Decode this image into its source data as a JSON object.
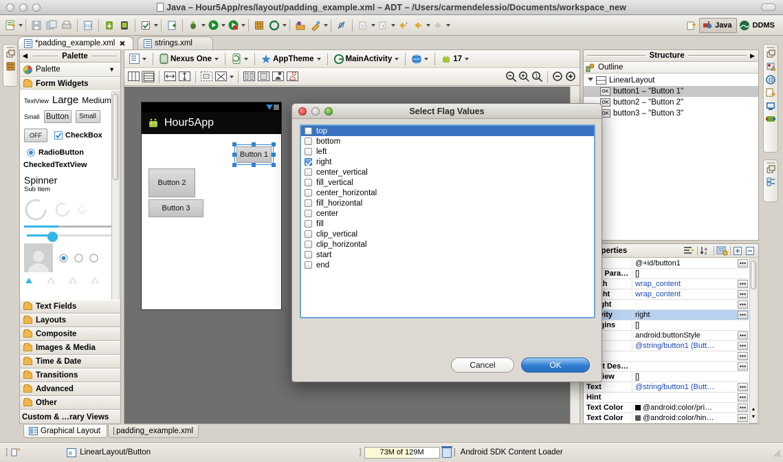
{
  "window": {
    "title": "Java – Hour5App/res/layout/padding_example.xml – ADT – /Users/carmendelessio/Documents/workspace_new",
    "doc_icon": "document-icon"
  },
  "toolbar": {
    "perspective_java": "Java",
    "perspective_ddms": "DDMS",
    "icons": [
      "new-wizard-icon",
      "save-icon",
      "save-all-icon",
      "print-icon",
      "open-xml-icon",
      "sdk-manager-icon",
      "avd-manager-icon",
      "checkmark-icon",
      "new-android-project-icon",
      "debug-icon",
      "run-icon",
      "coverage-icon",
      "new-grid-icon",
      "external-tools-icon",
      "open-type-icon",
      "search-icon",
      "annotation-icon",
      "next-annotation-icon",
      "previous-annotation-icon",
      "back-icon",
      "forward-icon"
    ]
  },
  "tabs": [
    {
      "label": "*padding_example.xml",
      "active": true,
      "closeable": true
    },
    {
      "label": "strings.xml",
      "active": false,
      "closeable": false
    }
  ],
  "palette": {
    "view_title": "Palette",
    "combo_label": "Palette",
    "form_widgets": "Form Widgets",
    "widgets": {
      "textview": "TextView",
      "large": "Large",
      "medium": "Medium",
      "small_label": "Small",
      "button": "Button",
      "small_button": "Small",
      "toggle_off": "OFF",
      "checkbox": "CheckBox",
      "radiobutton": "RadioButton",
      "checkedtextview": "CheckedTextView",
      "spinner": "Spinner",
      "spinner_sub": "Sub Item"
    },
    "groups": [
      "Text Fields",
      "Layouts",
      "Composite",
      "Images & Media",
      "Time & Date",
      "Transitions",
      "Advanced",
      "Other"
    ],
    "custom_group": "Custom & …rary Views"
  },
  "editor": {
    "config": {
      "device": "Nexus One",
      "theme": "AppTheme",
      "activity": "MainActivity",
      "api_level": "17"
    },
    "zoom_icons": [
      "zoom-out-icon",
      "zoom-fit-icon",
      "zoom-100-icon",
      "zoom-minus-icon",
      "zoom-plus-icon"
    ],
    "layout_icons": [
      "vertical-split-icon",
      "horizontal-split-icon",
      "match-width-icon",
      "match-height-icon",
      "wrap-content-icon",
      "distribute-icon",
      "show-margins-icon",
      "show-padding-icon",
      "portrait-icon",
      "landscape-icon"
    ]
  },
  "preview": {
    "app_title": "Hour5App",
    "buttons": [
      {
        "label": "Button 1",
        "selected": true
      },
      {
        "label": "Button 2",
        "selected": false
      },
      {
        "label": "Button 3",
        "selected": false
      }
    ]
  },
  "structure": {
    "view_title": "Structure",
    "outline_label": "Outline",
    "root": "LinearLayout",
    "children": [
      {
        "icon": "OK",
        "label": "button1 – \"Button 1\"",
        "selected": true
      },
      {
        "icon": "OK",
        "label": "button2 – \"Button 2\"",
        "selected": false
      },
      {
        "icon": "OK",
        "label": "button3 – \"Button 3\"",
        "selected": false
      }
    ]
  },
  "properties": {
    "view_title": "roperties",
    "header_icons": [
      "sort-by-category-icon",
      "sort-alpha-icon",
      "show-advanced-icon",
      "expand-all-icon",
      "collapse-all-icon"
    ],
    "rows": [
      {
        "name": "",
        "value": "@+id/button1",
        "dots": true,
        "blue": false,
        "selected": false
      },
      {
        "name": "yout Para…",
        "value": "[]",
        "dots": false,
        "blue": false,
        "selected": false
      },
      {
        "name": "Width",
        "value": "wrap_content",
        "dots": true,
        "blue": true,
        "selected": false
      },
      {
        "name": "Height",
        "value": "wrap_content",
        "dots": true,
        "blue": true,
        "selected": false
      },
      {
        "name": "Weight",
        "value": "",
        "dots": true,
        "blue": false,
        "selected": false
      },
      {
        "name": "Gravity",
        "value": "right",
        "dots": true,
        "blue": false,
        "selected": true
      },
      {
        "name": "Margins",
        "value": "[]",
        "dots": false,
        "blue": false,
        "selected": false
      },
      {
        "name": "yle",
        "value": "android:buttonStyle",
        "dots": true,
        "blue": false,
        "selected": false
      },
      {
        "name": "xt",
        "value": "@string/button1 (Butt…",
        "dots": true,
        "blue": true,
        "selected": false
      },
      {
        "name": "nt",
        "value": "",
        "dots": true,
        "blue": false,
        "selected": false
      },
      {
        "name": "ntent Des…",
        "value": "",
        "dots": true,
        "blue": false,
        "selected": false
      },
      {
        "name": "extView",
        "value": "[]",
        "dots": false,
        "blue": false,
        "selected": false
      },
      {
        "name": "Text",
        "value": "@string/button1 (Butt…",
        "dots": true,
        "blue": true,
        "selected": false
      },
      {
        "name": "Hint",
        "value": "",
        "dots": true,
        "blue": false,
        "selected": false
      },
      {
        "name": "Text Color",
        "value": "@android:color/pri…",
        "dots": true,
        "blue": false,
        "selected": false,
        "swatch": "#000000"
      },
      {
        "name": "Text Color",
        "value": "@android:color/hin…",
        "dots": true,
        "blue": false,
        "selected": false,
        "swatch": "#555555"
      }
    ]
  },
  "dialog": {
    "title": "Select Flag Values",
    "traffic_lights": [
      "close-button",
      "minimize-button",
      "zoom-button"
    ],
    "flags": [
      {
        "label": "top",
        "checked": false,
        "highlighted": true
      },
      {
        "label": "bottom",
        "checked": false,
        "highlighted": false
      },
      {
        "label": "left",
        "checked": false,
        "highlighted": false
      },
      {
        "label": "right",
        "checked": true,
        "highlighted": false
      },
      {
        "label": "center_vertical",
        "checked": false,
        "highlighted": false
      },
      {
        "label": "fill_vertical",
        "checked": false,
        "highlighted": false
      },
      {
        "label": "center_horizontal",
        "checked": false,
        "highlighted": false
      },
      {
        "label": "fill_horizontal",
        "checked": false,
        "highlighted": false
      },
      {
        "label": "center",
        "checked": false,
        "highlighted": false
      },
      {
        "label": "fill",
        "checked": false,
        "highlighted": false
      },
      {
        "label": "clip_vertical",
        "checked": false,
        "highlighted": false
      },
      {
        "label": "clip_horizontal",
        "checked": false,
        "highlighted": false
      },
      {
        "label": "start",
        "checked": false,
        "highlighted": false
      },
      {
        "label": "end",
        "checked": false,
        "highlighted": false
      }
    ],
    "cancel_label": "Cancel",
    "ok_label": "OK"
  },
  "bottom_tabs": [
    {
      "label": "Graphical Layout",
      "active": true
    },
    {
      "label": "padding_example.xml",
      "active": false
    }
  ],
  "status": {
    "selection": "LinearLayout/Button",
    "memory": "73M of 129M",
    "task": "Android SDK Content Loader",
    "trash_icon": "trash-icon"
  },
  "colors": {
    "selection_blue": "#3a72bf",
    "accent_blue": "#2f7cd1",
    "android_green": "#a4c639",
    "property_value_blue": "#1b47b8"
  }
}
